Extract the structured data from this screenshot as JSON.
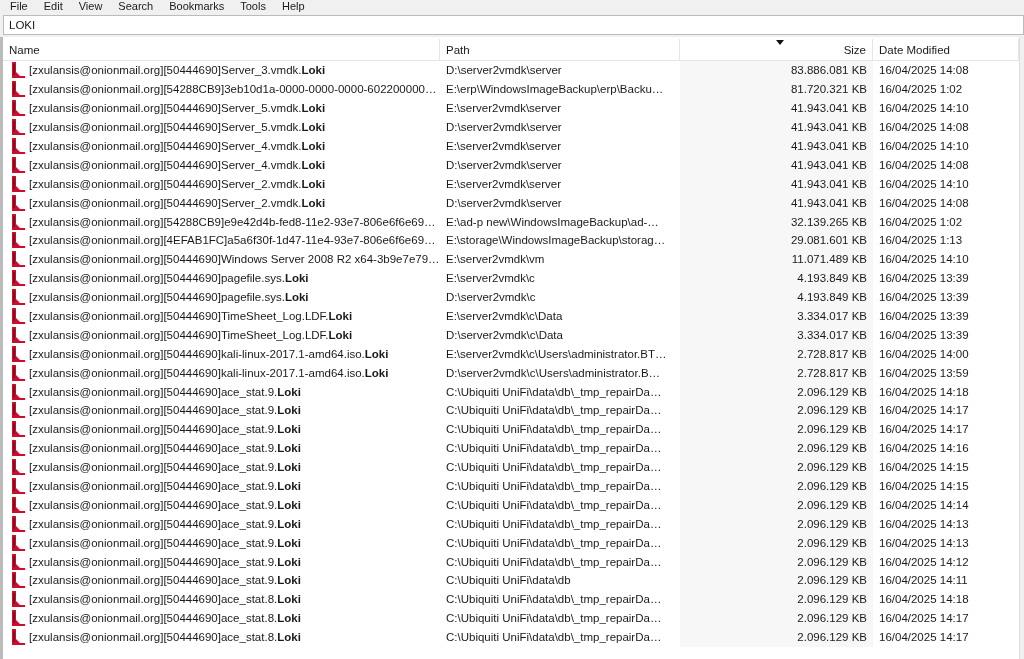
{
  "menu": [
    "File",
    "Edit",
    "View",
    "Search",
    "Bookmarks",
    "Tools",
    "Help"
  ],
  "search": {
    "value": "LOKI"
  },
  "table": {
    "columns": [
      {
        "label": "Name",
        "sorted": false
      },
      {
        "label": "Path",
        "sorted": false
      },
      {
        "label": "Size",
        "sorted": true
      },
      {
        "label": "Date Modified",
        "sorted": false
      }
    ],
    "rows": [
      [
        "[zxulansis@onionmail.org][50444690]Server_3.vmdk.**Loki**",
        "D:\\server2vmdk\\server",
        "83.886.081 KB",
        "16/04/2025 14:08"
      ],
      [
        "[zxulansis@onionmail.org][54288CB9]3eb10d1a-0000-0000-0000-602200000…",
        "E:\\erp\\WindowsImageBackup\\erp\\Backu…",
        "81.720.321 KB",
        "16/04/2025 1:02"
      ],
      [
        "[zxulansis@onionmail.org][50444690]Server_5.vmdk.**Loki**",
        "E:\\server2vmdk\\server",
        "41.943.041 KB",
        "16/04/2025 14:10"
      ],
      [
        "[zxulansis@onionmail.org][50444690]Server_5.vmdk.**Loki**",
        "D:\\server2vmdk\\server",
        "41.943.041 KB",
        "16/04/2025 14:08"
      ],
      [
        "[zxulansis@onionmail.org][50444690]Server_4.vmdk.**Loki**",
        "E:\\server2vmdk\\server",
        "41.943.041 KB",
        "16/04/2025 14:10"
      ],
      [
        "[zxulansis@onionmail.org][50444690]Server_4.vmdk.**Loki**",
        "D:\\server2vmdk\\server",
        "41.943.041 KB",
        "16/04/2025 14:08"
      ],
      [
        "[zxulansis@onionmail.org][50444690]Server_2.vmdk.**Loki**",
        "E:\\server2vmdk\\server",
        "41.943.041 KB",
        "16/04/2025 14:10"
      ],
      [
        "[zxulansis@onionmail.org][50444690]Server_2.vmdk.**Loki**",
        "D:\\server2vmdk\\server",
        "41.943.041 KB",
        "16/04/2025 14:08"
      ],
      [
        "[zxulansis@onionmail.org][54288CB9]e9e42d4b-fed8-11e2-93e7-806e6f6e69…",
        "E:\\ad-p new\\WindowsImageBackup\\ad-…",
        "32.139.265 KB",
        "16/04/2025 1:02"
      ],
      [
        "[zxulansis@onionmail.org][4EFAB1FC]a5a6f30f-1d47-11e4-93e7-806e6f6e69…",
        "E:\\storage\\WindowsImageBackup\\storag…",
        "29.081.601 KB",
        "16/04/2025 1:13"
      ],
      [
        "[zxulansis@onionmail.org][50444690]Windows Server 2008 R2 x64-3b9e7e79…",
        "E:\\server2vmdk\\vm",
        "11.071.489 KB",
        "16/04/2025 14:10"
      ],
      [
        "[zxulansis@onionmail.org][50444690]pagefile.sys.**Loki**",
        "E:\\server2vmdk\\c",
        "4.193.849 KB",
        "16/04/2025 13:39"
      ],
      [
        "[zxulansis@onionmail.org][50444690]pagefile.sys.**Loki**",
        "D:\\server2vmdk\\c",
        "4.193.849 KB",
        "16/04/2025 13:39"
      ],
      [
        "[zxulansis@onionmail.org][50444690]TimeSheet_Log.LDF.**Loki**",
        "E:\\server2vmdk\\c\\Data",
        "3.334.017 KB",
        "16/04/2025 13:39"
      ],
      [
        "[zxulansis@onionmail.org][50444690]TimeSheet_Log.LDF.**Loki**",
        "D:\\server2vmdk\\c\\Data",
        "3.334.017 KB",
        "16/04/2025 13:39"
      ],
      [
        "[zxulansis@onionmail.org][50444690]kali-linux-2017.1-amd64.iso.**Loki**",
        "E:\\server2vmdk\\c\\Users\\administrator.BT…",
        "2.728.817 KB",
        "16/04/2025 14:00"
      ],
      [
        "[zxulansis@onionmail.org][50444690]kali-linux-2017.1-amd64.iso.**Loki**",
        "D:\\server2vmdk\\c\\Users\\administrator.B…",
        "2.728.817 KB",
        "16/04/2025 13:59"
      ],
      [
        "[zxulansis@onionmail.org][50444690]ace_stat.9.**Loki**",
        "C:\\Ubiquiti UniFi\\data\\db\\_tmp_repairDa…",
        "2.096.129 KB",
        "16/04/2025 14:18"
      ],
      [
        "[zxulansis@onionmail.org][50444690]ace_stat.9.**Loki**",
        "C:\\Ubiquiti UniFi\\data\\db\\_tmp_repairDa…",
        "2.096.129 KB",
        "16/04/2025 14:17"
      ],
      [
        "[zxulansis@onionmail.org][50444690]ace_stat.9.**Loki**",
        "C:\\Ubiquiti UniFi\\data\\db\\_tmp_repairDa…",
        "2.096.129 KB",
        "16/04/2025 14:17"
      ],
      [
        "[zxulansis@onionmail.org][50444690]ace_stat.9.**Loki**",
        "C:\\Ubiquiti UniFi\\data\\db\\_tmp_repairDa…",
        "2.096.129 KB",
        "16/04/2025 14:16"
      ],
      [
        "[zxulansis@onionmail.org][50444690]ace_stat.9.**Loki**",
        "C:\\Ubiquiti UniFi\\data\\db\\_tmp_repairDa…",
        "2.096.129 KB",
        "16/04/2025 14:15"
      ],
      [
        "[zxulansis@onionmail.org][50444690]ace_stat.9.**Loki**",
        "C:\\Ubiquiti UniFi\\data\\db\\_tmp_repairDa…",
        "2.096.129 KB",
        "16/04/2025 14:15"
      ],
      [
        "[zxulansis@onionmail.org][50444690]ace_stat.9.**Loki**",
        "C:\\Ubiquiti UniFi\\data\\db\\_tmp_repairDa…",
        "2.096.129 KB",
        "16/04/2025 14:14"
      ],
      [
        "[zxulansis@onionmail.org][50444690]ace_stat.9.**Loki**",
        "C:\\Ubiquiti UniFi\\data\\db\\_tmp_repairDa…",
        "2.096.129 KB",
        "16/04/2025 14:13"
      ],
      [
        "[zxulansis@onionmail.org][50444690]ace_stat.9.**Loki**",
        "C:\\Ubiquiti UniFi\\data\\db\\_tmp_repairDa…",
        "2.096.129 KB",
        "16/04/2025 14:13"
      ],
      [
        "[zxulansis@onionmail.org][50444690]ace_stat.9.**Loki**",
        "C:\\Ubiquiti UniFi\\data\\db\\_tmp_repairDa…",
        "2.096.129 KB",
        "16/04/2025 14:12"
      ],
      [
        "[zxulansis@onionmail.org][50444690]ace_stat.9.**Loki**",
        "C:\\Ubiquiti UniFi\\data\\db",
        "2.096.129 KB",
        "16/04/2025 14:11"
      ],
      [
        "[zxulansis@onionmail.org][50444690]ace_stat.8.**Loki**",
        "C:\\Ubiquiti UniFi\\data\\db\\_tmp_repairDa…",
        "2.096.129 KB",
        "16/04/2025 14:18"
      ],
      [
        "[zxulansis@onionmail.org][50444690]ace_stat.8.**Loki**",
        "C:\\Ubiquiti UniFi\\data\\db\\_tmp_repairDa…",
        "2.096.129 KB",
        "16/04/2025 14:17"
      ],
      [
        "[zxulansis@onionmail.org][50444690]ace_stat.8.**Loki**",
        "C:\\Ubiquiti UniFi\\data\\db\\_tmp_repairDa…",
        "2.096.129 KB",
        "16/04/2025 14:17"
      ]
    ]
  }
}
